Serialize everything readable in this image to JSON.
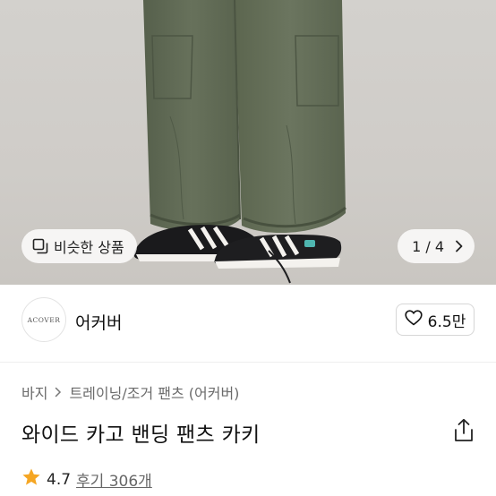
{
  "hero": {
    "similar_label": "비슷한 상품",
    "pager": "1 / 4"
  },
  "brand": {
    "logo_text": "ACOVER",
    "name": "어커버",
    "likes": "6.5만"
  },
  "breadcrumb": {
    "category": "바지",
    "subcategory": "트레이닝/조거 팬츠 (어커버)"
  },
  "product": {
    "title": "와이드 카고 밴딩 팬츠 카키",
    "rating": "4.7",
    "reviews": "후기 306개"
  },
  "colors": {
    "star": "#f5a623",
    "pants": "#626e58"
  }
}
